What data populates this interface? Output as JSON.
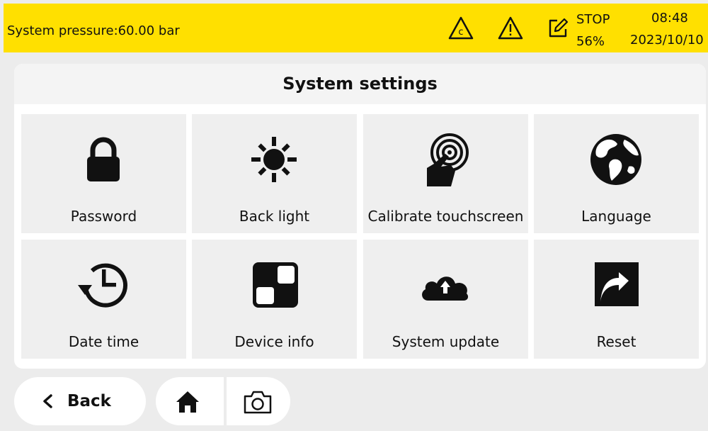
{
  "status_bar": {
    "pressure_text": "System pressure:60.00 bar",
    "calibration_icon": "calibration-warning-icon",
    "warning_icon": "warning-icon",
    "edit_icon": "edit-icon",
    "run_state": "STOP",
    "run_percent": "56%",
    "time": "08:48",
    "date": "2023/10/10",
    "accent_color": "#ffe000"
  },
  "panel": {
    "title": "System settings"
  },
  "tiles": [
    {
      "label": "Password",
      "icon": "lock-icon"
    },
    {
      "label": "Back light",
      "icon": "brightness-icon"
    },
    {
      "label": "Calibrate touchscreen",
      "icon": "touch-target-icon"
    },
    {
      "label": "Language",
      "icon": "globe-icon"
    },
    {
      "label": "Date time",
      "icon": "history-clock-icon"
    },
    {
      "label": "Device info",
      "icon": "device-info-icon"
    },
    {
      "label": "System update",
      "icon": "cloud-upload-icon"
    },
    {
      "label": "Reset",
      "icon": "reset-arrow-icon"
    }
  ],
  "footer": {
    "back_label": "Back",
    "back_icon": "chevron-left-icon",
    "home_icon": "home-icon",
    "camera_icon": "camera-icon"
  }
}
